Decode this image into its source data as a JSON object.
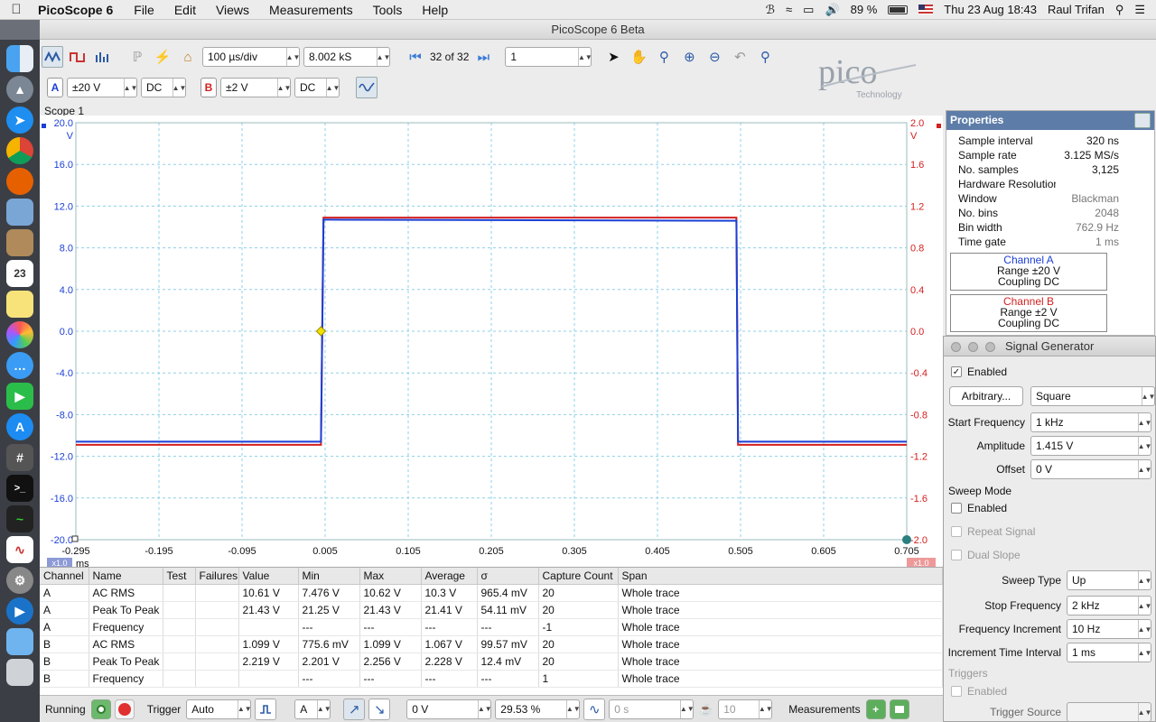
{
  "menubar": {
    "app_name": "PicoScope 6",
    "menus": [
      "File",
      "Edit",
      "Views",
      "Measurements",
      "Tools",
      "Help"
    ],
    "battery": "89 %",
    "datetime": "Thu 23 Aug  18:43",
    "user": "Raul Trifan"
  },
  "window": {
    "title": "PicoScope 6 Beta"
  },
  "toolbar": {
    "timebase": "100 µs/div",
    "samples": "8.002 kS",
    "buffer": "32 of 32",
    "zoom_value": "1"
  },
  "channels": [
    {
      "letter": "A",
      "range": "±20 V",
      "coupling": "DC",
      "color": "#1b3fd6"
    },
    {
      "letter": "B",
      "range": "±2 V",
      "coupling": "DC",
      "color": "#d42020"
    }
  ],
  "logo": {
    "name": "pico",
    "sub": "Technology"
  },
  "scope": {
    "title": "Scope 1",
    "left_ticks": [
      "20.0",
      "16.0",
      "12.0",
      "8.0",
      "4.0",
      "0.0",
      "-4.0",
      "-8.0",
      "-12.0",
      "-16.0",
      "-20.0"
    ],
    "left_unit": "V",
    "right_ticks": [
      "2.0",
      "1.6",
      "1.2",
      "0.8",
      "0.4",
      "0.0",
      "-0.4",
      "-0.8",
      "-1.2",
      "-1.6",
      "-2.0"
    ],
    "right_unit": "V",
    "x_ticks": [
      "-0.295",
      "-0.195",
      "-0.095",
      "0.005",
      "0.105",
      "0.205",
      "0.305",
      "0.405",
      "0.505",
      "0.605",
      "0.705"
    ],
    "x_unit": "ms",
    "x_zoom": "x1.0",
    "y_zoom_b": "x1.0"
  },
  "chart_data": {
    "type": "line",
    "x_unit": "ms",
    "xlim": [
      -0.295,
      0.705
    ],
    "series": [
      {
        "name": "A",
        "axis": "left",
        "ylim": [
          -20,
          20
        ],
        "x": [
          -0.295,
          0.0,
          0.003,
          0.006,
          0.5,
          0.502,
          0.507,
          0.705
        ],
        "y": [
          -10.6,
          -10.6,
          10.7,
          10.7,
          10.6,
          -10.6,
          -10.6,
          -10.6
        ]
      },
      {
        "name": "B",
        "axis": "right",
        "ylim": [
          -2,
          2
        ],
        "x": [
          -0.295,
          0.0,
          0.003,
          0.006,
          0.5,
          0.502,
          0.507,
          0.705
        ],
        "y": [
          -1.09,
          -1.09,
          1.09,
          1.09,
          1.09,
          -1.09,
          -1.09,
          -1.09
        ]
      }
    ],
    "grid": true
  },
  "properties": {
    "title": "Properties",
    "rows": [
      {
        "k": "Sample interval",
        "v": "320 ns",
        "grey": false
      },
      {
        "k": "Sample rate",
        "v": "3.125 MS/s",
        "grey": false
      },
      {
        "k": "No. samples",
        "v": "3,125",
        "grey": false
      },
      {
        "k": "Hardware Resolution",
        "v": "",
        "grey": false
      },
      {
        "k": "Window",
        "v": "Blackman",
        "grey": true
      },
      {
        "k": "No. bins",
        "v": "2048",
        "grey": true
      },
      {
        "k": "Bin width",
        "v": "762.9 Hz",
        "grey": true
      },
      {
        "k": "Time gate",
        "v": "1 ms",
        "grey": true
      }
    ],
    "ch_a": {
      "title": "Channel   A",
      "range": "Range     ±20 V",
      "coupling": "Coupling  DC"
    },
    "ch_b": {
      "title": "Channel   B",
      "range": "Range     ±2 V",
      "coupling": "Coupling  DC"
    }
  },
  "siggen": {
    "title": "Signal Generator",
    "enabled_label": "Enabled",
    "arbitrary": "Arbitrary...",
    "waveform": "Square",
    "start_freq_label": "Start Frequency",
    "start_freq": "1 kHz",
    "amplitude_label": "Amplitude",
    "amplitude": "1.415 V",
    "offset_label": "Offset",
    "offset": "0 V",
    "sweep_title": "Sweep Mode",
    "sweep_enabled": "Enabled",
    "repeat": "Repeat Signal",
    "dual": "Dual Slope",
    "sweep_type_label": "Sweep Type",
    "sweep_type": "Up",
    "stop_freq_label": "Stop Frequency",
    "stop_freq": "2 kHz",
    "freq_inc_label": "Frequency Increment",
    "freq_inc": "10 Hz",
    "inc_time_label": "Increment Time Interval",
    "inc_time": "1 ms",
    "triggers_title": "Triggers",
    "trig_enabled": "Enabled",
    "trig_source": "Trigger Source"
  },
  "measurements": {
    "headers": [
      "Channel",
      "Name",
      "Test",
      "Failures",
      "Value",
      "Min",
      "Max",
      "Average",
      "σ",
      "Capture Count",
      "Span"
    ],
    "rows": [
      [
        "A",
        "AC RMS",
        "",
        "",
        "10.61 V",
        "7.476 V",
        "10.62 V",
        "10.3 V",
        "965.4 mV",
        "20",
        "Whole trace"
      ],
      [
        "A",
        "Peak To Peak",
        "",
        "",
        "21.43 V",
        "21.25 V",
        "21.43 V",
        "21.41 V",
        "54.11 mV",
        "20",
        "Whole trace"
      ],
      [
        "A",
        "Frequency",
        "",
        "",
        "",
        "---",
        "---",
        "---",
        "---",
        "-1",
        "Whole trace"
      ],
      [
        "B",
        "AC RMS",
        "",
        "",
        "1.099 V",
        "775.6 mV",
        "1.099 V",
        "1.067 V",
        "99.57 mV",
        "20",
        "Whole trace"
      ],
      [
        "B",
        "Peak To Peak",
        "",
        "",
        "2.219 V",
        "2.201 V",
        "2.256 V",
        "2.228 V",
        "12.4 mV",
        "20",
        "Whole trace"
      ],
      [
        "B",
        "Frequency",
        "",
        "",
        "",
        "---",
        "---",
        "---",
        "---",
        "1",
        "Whole trace"
      ]
    ]
  },
  "statusbar": {
    "running": "Running",
    "trigger_label": "Trigger",
    "trigger_mode": "Auto",
    "trigger_channel": "A",
    "threshold": "0 V",
    "pretrigger": "29.53 %",
    "delay": "0 s",
    "count": "10",
    "measurements": "Measurements"
  }
}
